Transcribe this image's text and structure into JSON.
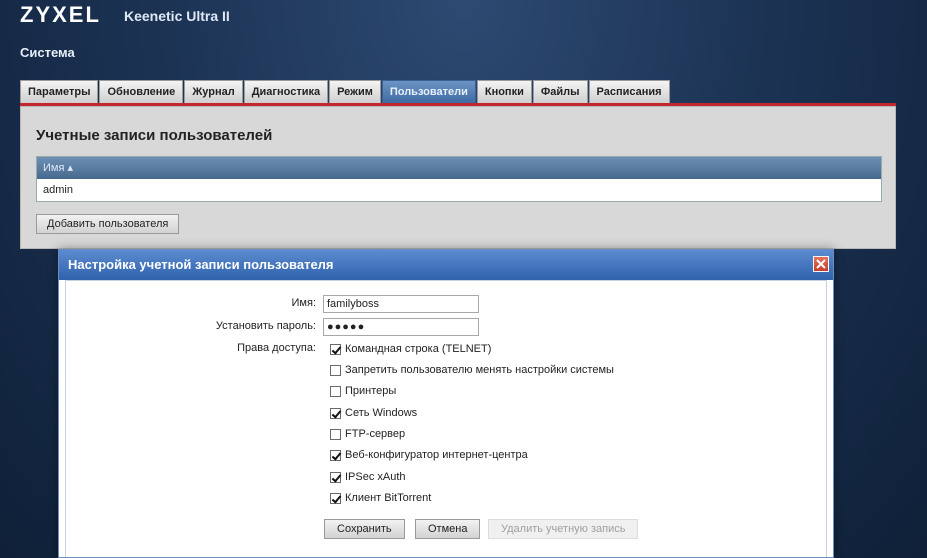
{
  "header": {
    "brand": "ZYXEL",
    "model": "Keenetic Ultra II",
    "section": "Система"
  },
  "tabs": [
    {
      "label": "Параметры"
    },
    {
      "label": "Обновление"
    },
    {
      "label": "Журнал"
    },
    {
      "label": "Диагностика"
    },
    {
      "label": "Режим"
    },
    {
      "label": "Пользователи",
      "active": true
    },
    {
      "label": "Кнопки"
    },
    {
      "label": "Файлы"
    },
    {
      "label": "Расписания"
    }
  ],
  "accounts": {
    "title": "Учетные записи пользователей",
    "column_header": "Имя ▴",
    "rows": [
      "admin"
    ],
    "add_button": "Добавить пользователя"
  },
  "dialog": {
    "title": "Настройка учетной записи пользователя",
    "name_label": "Имя:",
    "name_value": "familyboss",
    "password_label": "Установить пароль:",
    "password_value": "●●●●●",
    "access_label": "Права доступа:",
    "permissions": [
      {
        "label": "Командная строка (TELNET)",
        "checked": true
      },
      {
        "label": "Запретить пользователю менять настройки системы",
        "checked": false
      },
      {
        "label": "Принтеры",
        "checked": false
      },
      {
        "label": "Сеть Windows",
        "checked": true
      },
      {
        "label": "FTP-сервер",
        "checked": false
      },
      {
        "label": "Веб-конфигуратор интернет-центра",
        "checked": true
      },
      {
        "label": "IPSec xAuth",
        "checked": true
      },
      {
        "label": "Клиент BitTorrent",
        "checked": true
      }
    ],
    "save_button": "Сохранить",
    "cancel_button": "Отмена",
    "delete_button": "Удалить учетную запись"
  },
  "colors": {
    "accent_red": "#c0282d",
    "tab_active": "#4a74ad",
    "title_bar": "#2f62ad"
  }
}
